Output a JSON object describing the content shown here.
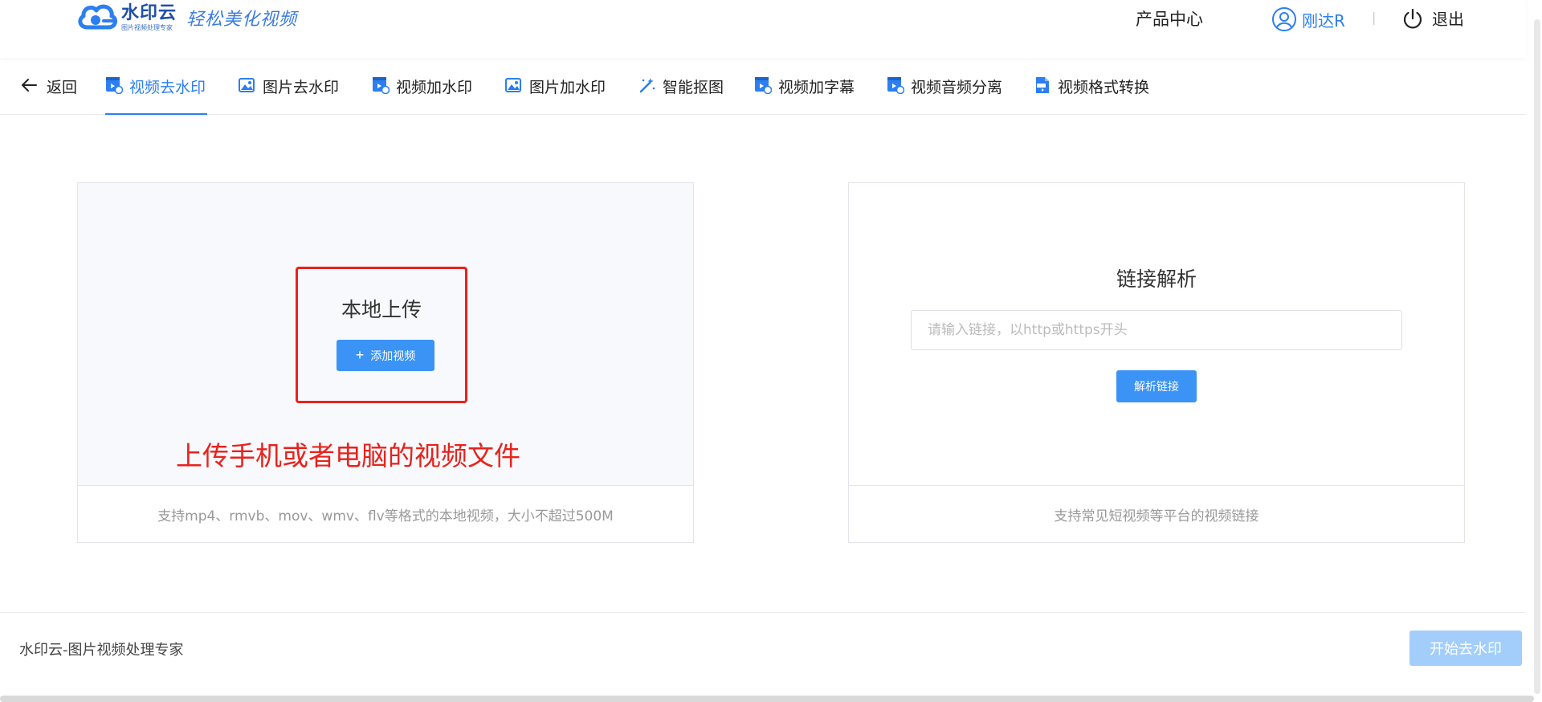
{
  "header": {
    "logo_name": "水印云",
    "logo_sub": "图片视频处理专家",
    "logo_slogan": "轻松美化视频",
    "product_center": "产品中心",
    "username": "刚达R",
    "separator": "|",
    "logout": "退出"
  },
  "tabs": {
    "back": "返回",
    "items": [
      {
        "label": "视频去水印",
        "icon": "video-icon",
        "active": true
      },
      {
        "label": "图片去水印",
        "icon": "image-icon",
        "active": false
      },
      {
        "label": "视频加水印",
        "icon": "video-icon",
        "active": false
      },
      {
        "label": "图片加水印",
        "icon": "image-icon",
        "active": false
      },
      {
        "label": "智能抠图",
        "icon": "magic-wand-icon",
        "active": false
      },
      {
        "label": "视频加字幕",
        "icon": "video-icon",
        "active": false
      },
      {
        "label": "视频音频分离",
        "icon": "video-icon",
        "active": false
      },
      {
        "label": "视频格式转换",
        "icon": "mp4-file-icon",
        "active": false
      }
    ]
  },
  "upload": {
    "title": "本地上传",
    "button": "添加视频",
    "annotation": "上传手机或者电脑的视频文件",
    "footer": "支持mp4、rmvb、mov、wmv、flv等格式的本地视频，大小不超过500M"
  },
  "link": {
    "title": "链接解析",
    "placeholder": "请输入链接，以http或https开头",
    "value": "",
    "button": "解析链接",
    "footer": "支持常见短视频等平台的视频链接"
  },
  "footer": {
    "text": "水印云-图片视频处理专家",
    "start_button": "开始去水印"
  },
  "colors": {
    "accent": "#2b7ff0",
    "button": "#3b93f5",
    "button_disabled": "#a3cefb",
    "annotation_red": "#e8221c"
  }
}
